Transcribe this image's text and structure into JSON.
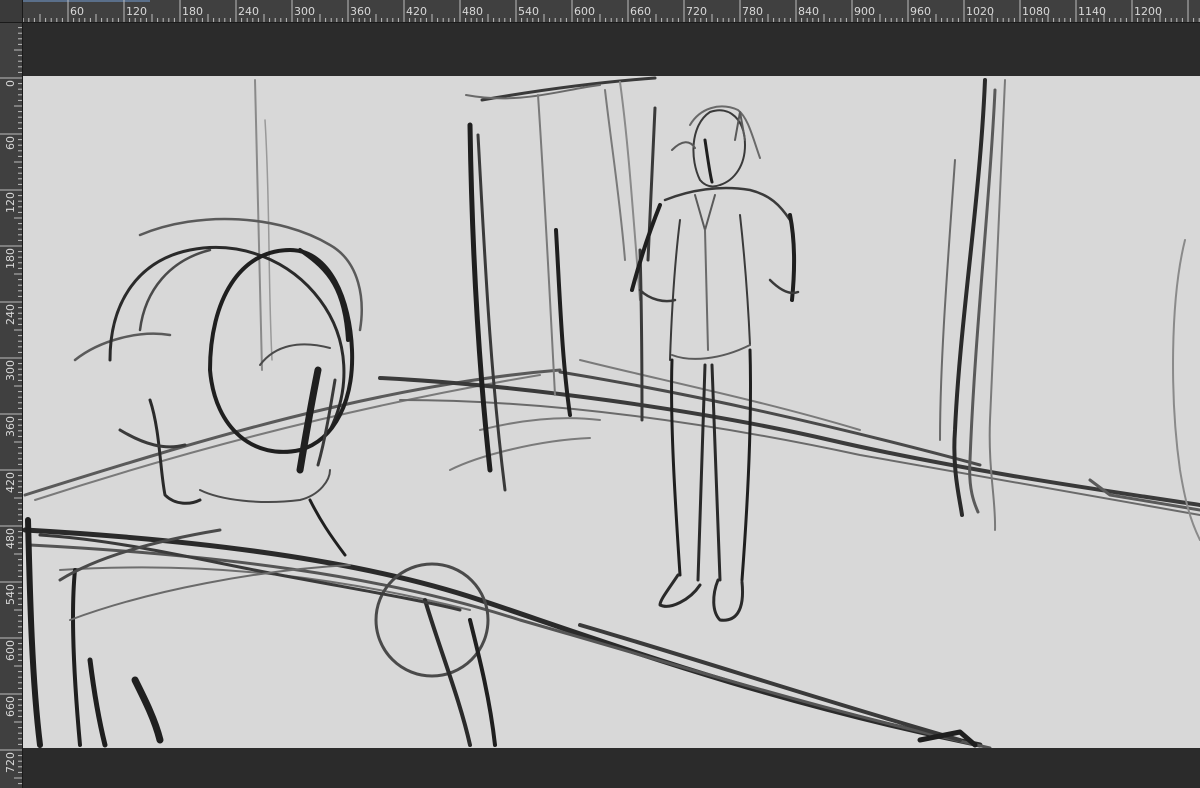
{
  "rulers": {
    "horizontal_labels": [
      "60",
      "120",
      "180",
      "240",
      "300",
      "360",
      "420",
      "480",
      "540",
      "600",
      "660",
      "720",
      "780",
      "840",
      "900",
      "960",
      "1020",
      "1080",
      "1140",
      "1200"
    ],
    "vertical_labels": [
      "0",
      "60",
      "120",
      "180",
      "240",
      "300",
      "360",
      "420",
      "480",
      "540",
      "600",
      "660",
      "720"
    ],
    "color_bg": "#404040",
    "color_text": "#d8d8d8"
  },
  "canvas": {
    "paper_color": "#d8d8d8",
    "pasteboard_color": "#2b2b2b",
    "stroke_dark": "#1f1f1f",
    "stroke_mid": "#4a4a4a",
    "stroke_light": "#7a7a7a"
  }
}
